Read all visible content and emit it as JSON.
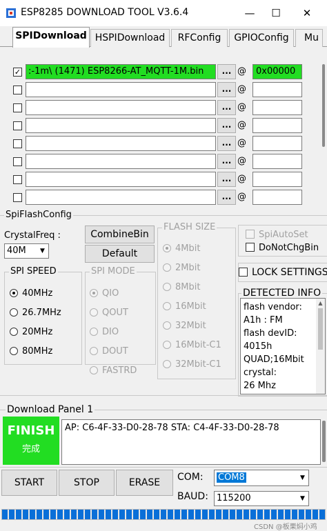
{
  "window": {
    "title": "ESP8285 DOWNLOAD TOOL V3.6.4",
    "minimize_glyph": "—",
    "maximize_glyph": "☐",
    "close_glyph": "✕"
  },
  "tabs": [
    {
      "label": "SPIDownload",
      "active": true
    },
    {
      "label": "HSPIDownload",
      "active": false
    },
    {
      "label": "RFConfig",
      "active": false
    },
    {
      "label": "GPIOConfig",
      "active": false
    },
    {
      "label": "Mu",
      "active": false
    }
  ],
  "file_rows": [
    {
      "checked": true,
      "path": ":-1m\\  (1471)  ESP8266-AT_MQTT-1M.bin",
      "browse": "...",
      "at": "@",
      "address": "0x00000",
      "highlight": true
    },
    {
      "checked": false,
      "path": "",
      "browse": "...",
      "at": "@",
      "address": "",
      "highlight": false
    },
    {
      "checked": false,
      "path": "",
      "browse": "...",
      "at": "@",
      "address": "",
      "highlight": false
    },
    {
      "checked": false,
      "path": "",
      "browse": "...",
      "at": "@",
      "address": "",
      "highlight": false
    },
    {
      "checked": false,
      "path": "",
      "browse": "...",
      "at": "@",
      "address": "",
      "highlight": false
    },
    {
      "checked": false,
      "path": "",
      "browse": "...",
      "at": "@",
      "address": "",
      "highlight": false
    },
    {
      "checked": false,
      "path": "",
      "browse": "...",
      "at": "@",
      "address": "",
      "highlight": false
    },
    {
      "checked": false,
      "path": "",
      "browse": "...",
      "at": "@",
      "address": "",
      "highlight": false
    }
  ],
  "check_glyph": "✓",
  "spi_flash_config": {
    "title": "SpiFlashConfig",
    "crystal_label": "CrystalFreq :",
    "crystal_value": "40M",
    "combine_button": "CombineBin",
    "default_button": "Default",
    "flash_size": {
      "title": "FLASH SIZE",
      "options": [
        "4Mbit",
        "2Mbit",
        "8Mbit",
        "16Mbit",
        "32Mbit",
        "16Mbit-C1",
        "32Mbit-C1"
      ],
      "selected": 0
    },
    "spi_speed": {
      "title": "SPI SPEED",
      "options": [
        "40MHz",
        "26.7MHz",
        "20MHz",
        "80MHz"
      ],
      "selected": 0
    },
    "spi_mode": {
      "title": "SPI MODE",
      "options": [
        "QIO",
        "QOUT",
        "DIO",
        "DOUT",
        "FASTRD"
      ],
      "selected": 0
    },
    "spi_auto_set": "SpiAutoSet",
    "do_not_chg_bin": "DoNotChgBin",
    "lock_settings": "LOCK SETTINGS",
    "detected_info": {
      "title": "DETECTED INFO",
      "lines": [
        "flash vendor:",
        "A1h : FM",
        "flash devID:",
        "4015h",
        "QUAD;16Mbit",
        "crystal:",
        "26 Mhz"
      ]
    }
  },
  "download_panel": {
    "title": "Download Panel 1",
    "status": "FINISH",
    "status_cn": "完成",
    "mac_info": "AP:  C6-4F-33-D0-28-78   STA:  C4-4F-33-D0-28-78",
    "start_button": "START",
    "stop_button": "STOP",
    "erase_button": "ERASE",
    "com_label": "COM:",
    "com_value": "COM8",
    "baud_label": "BAUD:",
    "baud_value": "115200",
    "progress_fraction": 1.0
  },
  "watermark": "CSDN @板栗焖小鸡",
  "colors": {
    "status_green": "#22dd22",
    "progress_blue": "#0a6fd8",
    "select_blue": "#0078d7"
  }
}
